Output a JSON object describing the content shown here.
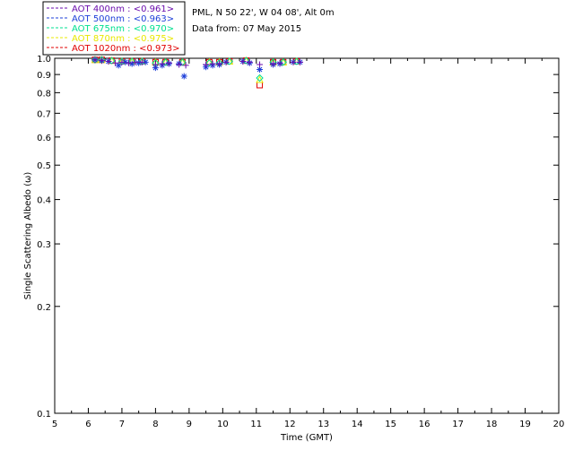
{
  "header": {
    "site": "PML, N 50 22', W 04 08', Alt 0m",
    "date": "Data from: 07 May 2015"
  },
  "colors": {
    "aot400": "#6a0dad",
    "aot500": "#1e3fd9",
    "aot675": "#00e090",
    "aot870": "#e8e800",
    "aot1020": "#e00000"
  },
  "chart_data": {
    "type": "scatter",
    "xlabel": "Time (GMT)",
    "ylabel": "Single Scattering Albedo (ω)",
    "xlim": [
      5,
      20
    ],
    "ylim": [
      0.1,
      1.0
    ],
    "yscale": "log",
    "xticks": [
      "5",
      "6",
      "7",
      "8",
      "9",
      "10",
      "11",
      "12",
      "13",
      "14",
      "15",
      "16",
      "17",
      "18",
      "19",
      "20"
    ],
    "yticks": [
      "0.1",
      "0.2",
      "0.3",
      "0.4",
      "0.5",
      "0.6",
      "0.7",
      "0.8",
      "0.9",
      "1.0"
    ],
    "grid": false,
    "legend": "top-left, outside",
    "series": [
      {
        "name": "AOT  400nm : <0.961>",
        "marker": "plus",
        "x": [
          6.2,
          6.4,
          6.6,
          6.8,
          7.0,
          7.2,
          7.4,
          7.6,
          8.0,
          8.2,
          8.4,
          8.7,
          8.9,
          9.5,
          9.7,
          9.9,
          10.1,
          10.6,
          10.8,
          11.1,
          11.5,
          11.7,
          12.1,
          12.3
        ],
        "y": [
          0.99,
          0.985,
          0.98,
          0.97,
          0.975,
          0.97,
          0.975,
          0.975,
          0.96,
          0.965,
          0.97,
          0.96,
          0.955,
          0.96,
          0.965,
          0.965,
          0.975,
          0.98,
          0.975,
          0.96,
          0.965,
          0.97,
          0.975,
          0.975
        ]
      },
      {
        "name": "AOT  500nm : <0.963>",
        "marker": "asterisk",
        "x": [
          6.2,
          6.4,
          6.6,
          6.9,
          7.1,
          7.3,
          7.5,
          7.7,
          8.0,
          8.2,
          8.4,
          8.7,
          8.85,
          9.5,
          9.7,
          9.9,
          10.1,
          10.6,
          10.8,
          11.1,
          11.5,
          11.7,
          12.1,
          12.3
        ],
        "y": [
          0.99,
          0.985,
          0.98,
          0.955,
          0.975,
          0.965,
          0.97,
          0.975,
          0.94,
          0.955,
          0.965,
          0.965,
          0.89,
          0.945,
          0.955,
          0.96,
          0.975,
          0.98,
          0.97,
          0.93,
          0.96,
          0.965,
          0.975,
          0.975
        ]
      },
      {
        "name": "AOT  675nm : <0.970>",
        "marker": "diamond",
        "x": [
          6.2,
          6.4,
          6.7,
          7.0,
          7.3,
          7.6,
          8.0,
          8.3,
          8.8,
          9.6,
          9.9,
          10.2,
          10.7,
          11.1,
          11.5,
          11.8,
          12.2
        ],
        "y": [
          0.99,
          0.99,
          0.985,
          0.98,
          0.98,
          0.98,
          0.97,
          0.975,
          0.975,
          0.97,
          0.97,
          0.98,
          0.985,
          0.88,
          0.975,
          0.975,
          0.98
        ]
      },
      {
        "name": "AOT  870nm : <0.975>",
        "marker": "triangle",
        "x": [
          6.2,
          6.4,
          6.7,
          7.0,
          7.3,
          7.6,
          8.0,
          8.3,
          8.8,
          9.6,
          9.9,
          10.2,
          10.7,
          11.1,
          11.5,
          11.8,
          12.2
        ],
        "y": [
          0.99,
          0.99,
          0.985,
          0.98,
          0.98,
          0.98,
          0.975,
          0.975,
          0.975,
          0.975,
          0.975,
          0.98,
          0.985,
          0.87,
          0.975,
          0.975,
          0.98
        ]
      },
      {
        "name": "AOT 1020nm : <0.973>",
        "marker": "square",
        "x": [
          6.2,
          6.4,
          6.7,
          7.0,
          7.3,
          7.6,
          8.0,
          8.3,
          8.8,
          9.6,
          9.9,
          10.2,
          10.7,
          11.1,
          11.5,
          11.8,
          12.2
        ],
        "y": [
          0.99,
          0.99,
          0.985,
          0.98,
          0.98,
          0.98,
          0.975,
          0.975,
          0.975,
          0.975,
          0.975,
          0.98,
          0.985,
          0.84,
          0.975,
          0.975,
          0.98
        ]
      }
    ]
  }
}
